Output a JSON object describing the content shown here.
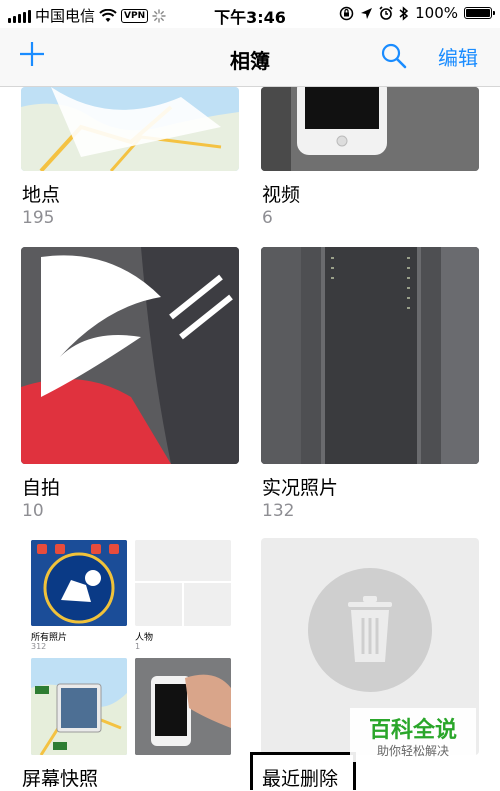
{
  "status_bar": {
    "carrier": "中国电信",
    "vpn": "VPN",
    "time": "下午3:46",
    "battery": "100%"
  },
  "nav": {
    "add_icon": "plus-icon",
    "title": "相簿",
    "search_icon": "search-icon",
    "edit_label": "编辑"
  },
  "albums": [
    {
      "title": "地点",
      "count": "195"
    },
    {
      "title": "视频",
      "count": "6"
    },
    {
      "title": "自拍",
      "count": "10"
    },
    {
      "title": "实况照片",
      "count": "132"
    },
    {
      "title": "屏幕快照",
      "count": ""
    },
    {
      "title": "最近删除",
      "count": ""
    }
  ],
  "composite": {
    "all_photos_label": "所有照片",
    "all_photos_count": "312",
    "people_label": "人物",
    "people_count": "1"
  },
  "watermark": {
    "title": "百科全说",
    "subtitle": "助你轻松解决"
  },
  "colors": {
    "accent": "#1a8cff",
    "count_gray": "#8e8e93"
  }
}
